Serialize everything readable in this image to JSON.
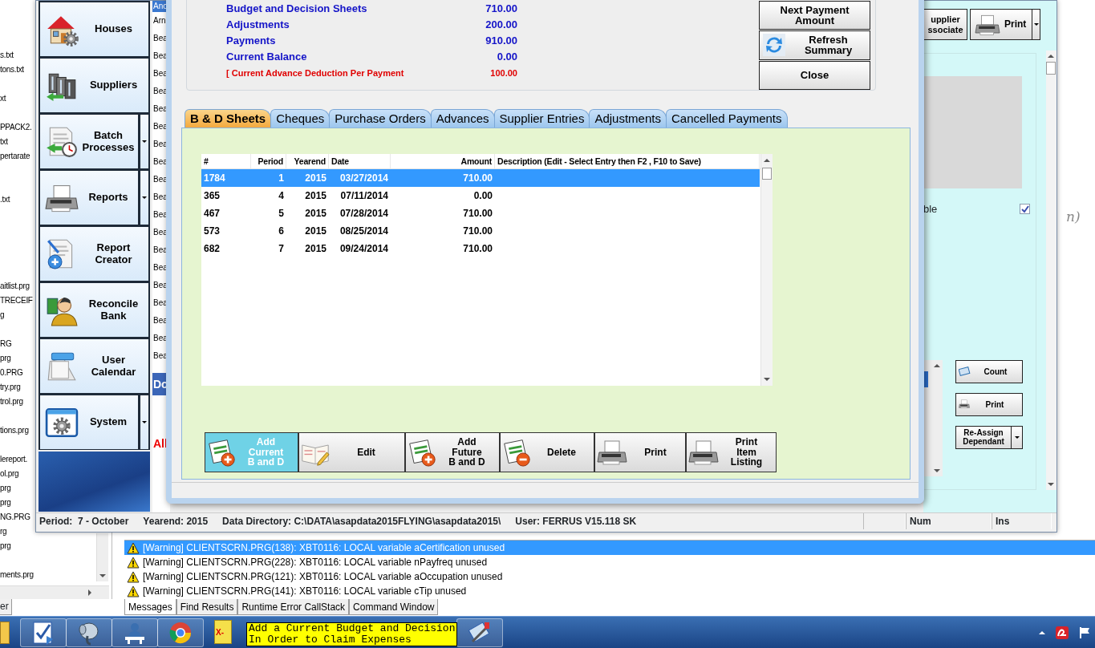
{
  "desktop": {
    "behind_text": "n)",
    "files": [
      {
        "text": "s.txt",
        "kind": "plain"
      },
      {
        "text": "tons.txt",
        "kind": "plain"
      },
      {
        "text": "xt",
        "kind": "spaced"
      },
      {
        "text": "PPACK2.",
        "kind": "spaced"
      },
      {
        "text": "txt",
        "kind": "plain"
      },
      {
        "text": "pertarate",
        "kind": "plain"
      },
      {
        "text": ".txt",
        "kind": "doublespaced"
      },
      {
        "text": "aitlist.prg",
        "kind": "farspaced"
      },
      {
        "text": "TRECEIF",
        "kind": "plain"
      },
      {
        "text": "g",
        "kind": "plain"
      },
      {
        "text": "RG",
        "kind": "spaced"
      },
      {
        "text": "prg",
        "kind": "plain"
      },
      {
        "text": "0.PRG",
        "kind": "plain"
      },
      {
        "text": "try.prg",
        "kind": "plain"
      },
      {
        "text": "trol.prg",
        "kind": "plain"
      },
      {
        "text": "tions.prg",
        "kind": "spaced"
      },
      {
        "text": "lereport.",
        "kind": "spaced"
      },
      {
        "text": "ol.prg",
        "kind": "plain"
      },
      {
        "text": "prg",
        "kind": "plain"
      },
      {
        "text": "prg",
        "kind": "plain"
      },
      {
        "text": "NG.PRG",
        "kind": "plain"
      },
      {
        "text": "rg",
        "kind": "plain"
      },
      {
        "text": "prg",
        "kind": "plain"
      },
      {
        "text": "ments.prg",
        "kind": "spaced"
      }
    ]
  },
  "main_window": {
    "nav": [
      {
        "label": [
          "Houses"
        ],
        "dropdown": false
      },
      {
        "label": [
          "Suppliers"
        ],
        "dropdown": false
      },
      {
        "label": [
          "Batch",
          "Processes"
        ],
        "dropdown": true
      },
      {
        "label": [
          "Reports"
        ],
        "dropdown": true
      },
      {
        "label": [
          "Report",
          "Creator"
        ],
        "dropdown": false
      },
      {
        "label": [
          "Reconcile",
          "Bank"
        ],
        "dropdown": false
      },
      {
        "label": [
          "User",
          "Calendar"
        ],
        "dropdown": false
      },
      {
        "label": [
          "System"
        ],
        "dropdown": true
      }
    ],
    "list_column": {
      "header": "Ano",
      "items": [
        "Arn",
        "Bea",
        "Bea",
        "Bea",
        "Bea",
        "Bea",
        "Bea",
        "Bea",
        "Bea",
        "Bea",
        "Bea",
        "Bea",
        "Bea",
        "Bea",
        "Bea",
        "Bea",
        "Bea",
        "Bea",
        "Bea",
        "Bea"
      ],
      "band_label": "Do",
      "alert_label": "All"
    },
    "right_panel": {
      "associate_button": [
        "upplier",
        "ssociate"
      ],
      "print_button": "Print",
      "option_label": "ble",
      "option_checked": true,
      "buttons": [
        {
          "label": [
            "Count"
          ],
          "dropdown": false
        },
        {
          "label": [
            "Print"
          ],
          "dropdown": false
        },
        {
          "label": [
            "Re-Assign",
            "Dependant"
          ],
          "dropdown": true
        }
      ]
    },
    "status_bar": {
      "fields": [
        "Period:  7 - October",
        "Yearend: 2015",
        "Data Directory: C:\\DATA\\asapdata2015FLYING\\asapdata2015\\",
        "User: FERRUS V15.118 SK"
      ],
      "indicators": [
        "Num",
        "Ins"
      ]
    }
  },
  "dialog": {
    "summary": [
      {
        "label": "Budget and Decision Sheets",
        "value": "710.00",
        "kind": "total"
      },
      {
        "label": "Adjustments",
        "value": "200.00",
        "kind": "total"
      },
      {
        "label": "Payments",
        "value": "910.00",
        "kind": "total"
      },
      {
        "label": "Current Balance",
        "value": "0.00",
        "kind": "total"
      },
      {
        "label": "[ Current Advance Deduction Per Payment",
        "value": "100.00",
        "kind": "note"
      }
    ],
    "buttons": [
      {
        "label": [
          "Next Payment",
          "Amount"
        ],
        "kind": "plain"
      },
      {
        "label": [
          "Refresh",
          "Summary"
        ],
        "kind": "refresh"
      },
      {
        "label": [
          "Close"
        ],
        "kind": "plain"
      }
    ],
    "tabs": [
      {
        "label": "B & D Sheets",
        "selected": true
      },
      {
        "label": "Cheques",
        "selected": false
      },
      {
        "label": "Purchase Orders",
        "selected": false
      },
      {
        "label": "Advances",
        "selected": false
      },
      {
        "label": "Supplier Entries",
        "selected": false
      },
      {
        "label": "Adjustments",
        "selected": false
      },
      {
        "label": "Cancelled Payments",
        "selected": false
      }
    ],
    "table": {
      "columns": [
        "#",
        "Period",
        "Yearend",
        "Date",
        "Amount",
        "Description (Edit - Select Entry then F2 , F10 to Save)"
      ],
      "rows": [
        {
          "cells": [
            "1784",
            "1",
            "2015",
            "03/27/2014",
            "710.00"
          ],
          "selected": true
        },
        {
          "cells": [
            "365",
            "4",
            "2015",
            "07/11/2014",
            "0.00"
          ],
          "selected": false
        },
        {
          "cells": [
            "467",
            "5",
            "2015",
            "07/28/2014",
            "710.00"
          ],
          "selected": false
        },
        {
          "cells": [
            "573",
            "6",
            "2015",
            "08/25/2014",
            "710.00"
          ],
          "selected": false
        },
        {
          "cells": [
            "682",
            "7",
            "2015",
            "09/24/2014",
            "710.00"
          ],
          "selected": false
        }
      ]
    },
    "actions": [
      {
        "label": [
          "Add",
          "Current",
          "B and D"
        ],
        "kind": "add",
        "active": true
      },
      {
        "label": [
          "Edit"
        ],
        "kind": "edit",
        "active": false
      },
      {
        "label": [
          "Add",
          "Future",
          "B and D"
        ],
        "kind": "add",
        "active": false
      },
      {
        "label": [
          "Delete"
        ],
        "kind": "delete",
        "active": false
      },
      {
        "label": [
          "Print"
        ],
        "kind": "print",
        "active": false
      },
      {
        "label": [
          "Print",
          "Item",
          "Listing"
        ],
        "kind": "print",
        "active": false
      }
    ]
  },
  "messages": {
    "rows": [
      {
        "text": "[Warning] CLIENTSCRN.PRG(138): XBT0116: LOCAL variable aCertification unused",
        "selected": true
      },
      {
        "text": "[Warning] CLIENTSCRN.PRG(228): XBT0116: LOCAL variable nPayfreq unused",
        "selected": false
      },
      {
        "text": "[Warning] CLIENTSCRN.PRG(121): XBT0116: LOCAL variable aOccupation unused",
        "selected": false
      },
      {
        "text": "[Warning] CLIENTSCRN.PRG(141): XBT0116: LOCAL variable cTip unused",
        "selected": false
      }
    ],
    "tabs": [
      {
        "label": "Messages",
        "selected": true
      },
      {
        "label": "Find Results",
        "selected": false
      },
      {
        "label": "Runtime Error CallStack",
        "selected": false
      },
      {
        "label": "Command Window",
        "selected": false
      }
    ],
    "side_tab": "er"
  },
  "taskbar": {
    "badge": "X-",
    "tooltip": [
      "Add a Current Budget and Decision",
      "In Order to Claim Expenses"
    ]
  }
}
